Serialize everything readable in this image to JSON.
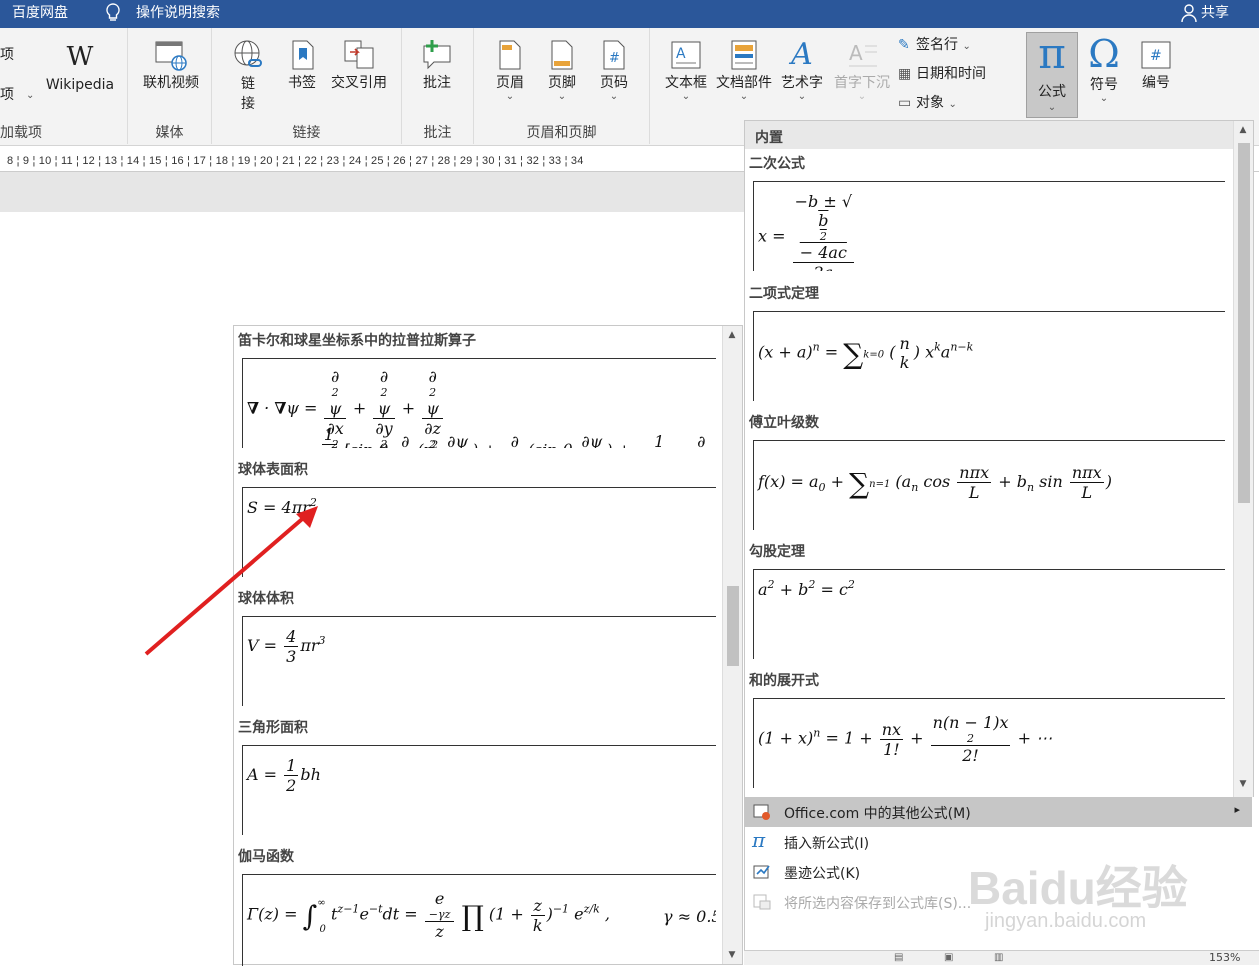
{
  "titlebar": {
    "left_items": [
      "百度网盘",
      "操作说明搜索"
    ],
    "share": "共享"
  },
  "ribbon": {
    "partial_left": {
      "item1": "项",
      "item2": "项",
      "group": "加载项"
    },
    "wikipedia": "Wikipedia",
    "media": {
      "online_video": "联机视频",
      "group": "媒体"
    },
    "links": {
      "link": "链\n接",
      "bookmark": "书签",
      "cross_ref": "交叉引用",
      "group": "链接"
    },
    "comments": {
      "comment": "批注",
      "group": "批注"
    },
    "header_footer": {
      "header": "页眉",
      "footer": "页脚",
      "page_number": "页码",
      "group": "页眉和页脚"
    },
    "text": {
      "textbox": "文本框",
      "quick_parts": "文档部件",
      "wordart": "艺术字",
      "dropcap": "首字下沉",
      "signature": "签名行",
      "datetime": "日期和时间",
      "object": "对象"
    },
    "symbols": {
      "equation": "公式",
      "symbol": "符号",
      "numbering": "编号"
    }
  },
  "ruler": {
    "numbers": [
      "8",
      "9",
      "10",
      "11",
      "12",
      "13",
      "14",
      "15",
      "16",
      "17",
      "18",
      "19",
      "20",
      "21",
      "22",
      "23",
      "24",
      "25",
      "26",
      "27",
      "28",
      "29",
      "30",
      "31",
      "32",
      "33",
      "34"
    ]
  },
  "left_pane": {
    "sections": [
      "笛卡尔和球星坐标系中的拉普拉斯算子",
      "球体表面积",
      "球体体积",
      "三角形面积",
      "伽马函数"
    ],
    "gamma_tail": "γ ≈ 0.5"
  },
  "right_pane": {
    "header": "内置",
    "sections": [
      "二次公式",
      "二项式定理",
      "傅立叶级数",
      "勾股定理",
      "和的展开式"
    ]
  },
  "menu": {
    "items": [
      {
        "label": "Office.com 中的其他公式(M)",
        "icon": "office-icon",
        "arrow": "▸"
      },
      {
        "label": "插入新公式(I)",
        "icon": "pi-icon"
      },
      {
        "label": "墨迹公式(K)",
        "icon": "ink-icon"
      },
      {
        "label": "将所选内容保存到公式库(S)...",
        "icon": "save-gallery-icon"
      }
    ]
  },
  "status": {
    "zoom": "153%"
  },
  "watermark": {
    "text": "Baidu经验",
    "url": "jingyan.baidu.com"
  }
}
